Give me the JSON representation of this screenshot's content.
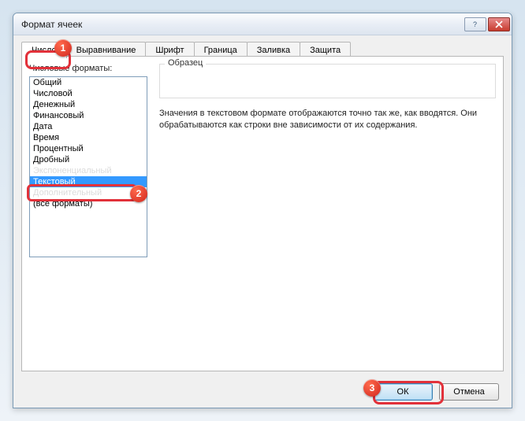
{
  "window": {
    "title": "Формат ячеек"
  },
  "tabs": [
    {
      "label": "Число",
      "active": true
    },
    {
      "label": "Выравнивание",
      "active": false
    },
    {
      "label": "Шрифт",
      "active": false
    },
    {
      "label": "Граница",
      "active": false
    },
    {
      "label": "Заливка",
      "active": false
    },
    {
      "label": "Защита",
      "active": false
    }
  ],
  "left": {
    "label": "Числовые форматы:",
    "items": [
      {
        "label": "Общий",
        "selected": false
      },
      {
        "label": "Числовой",
        "selected": false
      },
      {
        "label": "Денежный",
        "selected": false
      },
      {
        "label": "Финансовый",
        "selected": false
      },
      {
        "label": "Дата",
        "selected": false
      },
      {
        "label": "Время",
        "selected": false
      },
      {
        "label": "Процентный",
        "selected": false
      },
      {
        "label": "Дробный",
        "selected": false
      },
      {
        "label": "Экспоненциальный",
        "selected": false
      },
      {
        "label": "Текстовый",
        "selected": true
      },
      {
        "label": "Дополнительный",
        "selected": false
      },
      {
        "label": "(все форматы)",
        "selected": false
      }
    ]
  },
  "right": {
    "sample_label": "Образец",
    "description": "Значения в текстовом формате отображаются точно так же, как вводятся. Они обрабатываются как строки вне зависимости от их содержания."
  },
  "footer": {
    "ok": "ОК",
    "cancel": "Отмена"
  },
  "callouts": {
    "b1": "1",
    "b2": "2",
    "b3": "3"
  }
}
